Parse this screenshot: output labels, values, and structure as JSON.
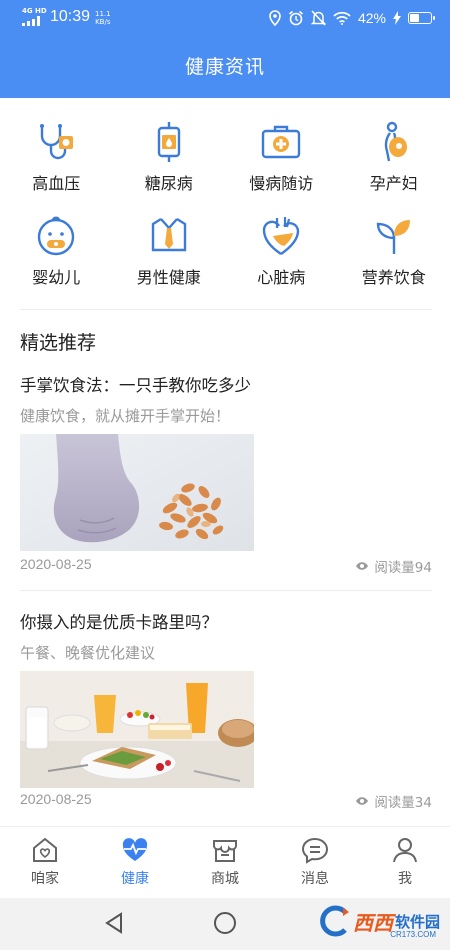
{
  "status_bar": {
    "network": "4G HD",
    "time": "10:39",
    "speed_value": "11.1",
    "speed_unit": "KB/s",
    "battery": "42%"
  },
  "header": {
    "title": "健康资讯"
  },
  "categories": [
    {
      "label": "高血压",
      "icon": "stethoscope-icon"
    },
    {
      "label": "糖尿病",
      "icon": "iv-bag-icon"
    },
    {
      "label": "慢病随访",
      "icon": "medical-kit-icon"
    },
    {
      "label": "孕产妇",
      "icon": "pregnant-icon"
    },
    {
      "label": "婴幼儿",
      "icon": "baby-icon"
    },
    {
      "label": "男性健康",
      "icon": "shirt-icon"
    },
    {
      "label": "心脏病",
      "icon": "heart-organ-icon"
    },
    {
      "label": "营养饮食",
      "icon": "sprout-icon"
    }
  ],
  "featured": {
    "title": "精选推荐",
    "articles": [
      {
        "title": "手掌饮食法：一只手教你吃多少",
        "subtitle": "健康饮食，就从摊开手掌开始！",
        "date": "2020-08-25",
        "views": "阅读量94"
      },
      {
        "title": "你摄入的是优质卡路里吗？",
        "subtitle": "午餐、晚餐优化建议",
        "date": "2020-08-25",
        "views": "阅读量34"
      }
    ]
  },
  "tabbar": {
    "tabs": [
      {
        "label": "咱家",
        "icon": "home-icon",
        "active": false
      },
      {
        "label": "健康",
        "icon": "heart-pulse-icon",
        "active": true
      },
      {
        "label": "商城",
        "icon": "shop-icon",
        "active": false
      },
      {
        "label": "消息",
        "icon": "message-icon",
        "active": false
      },
      {
        "label": "我",
        "icon": "profile-icon",
        "active": false
      }
    ]
  },
  "watermark": {
    "brand": "西西",
    "text": "软件园",
    "domain": "CR173.COM"
  },
  "colors": {
    "primary": "#4a8df3",
    "active_tab": "#3b82f0",
    "muted_text": "#9a9a9a",
    "icon_orange": "#f4a93c"
  }
}
